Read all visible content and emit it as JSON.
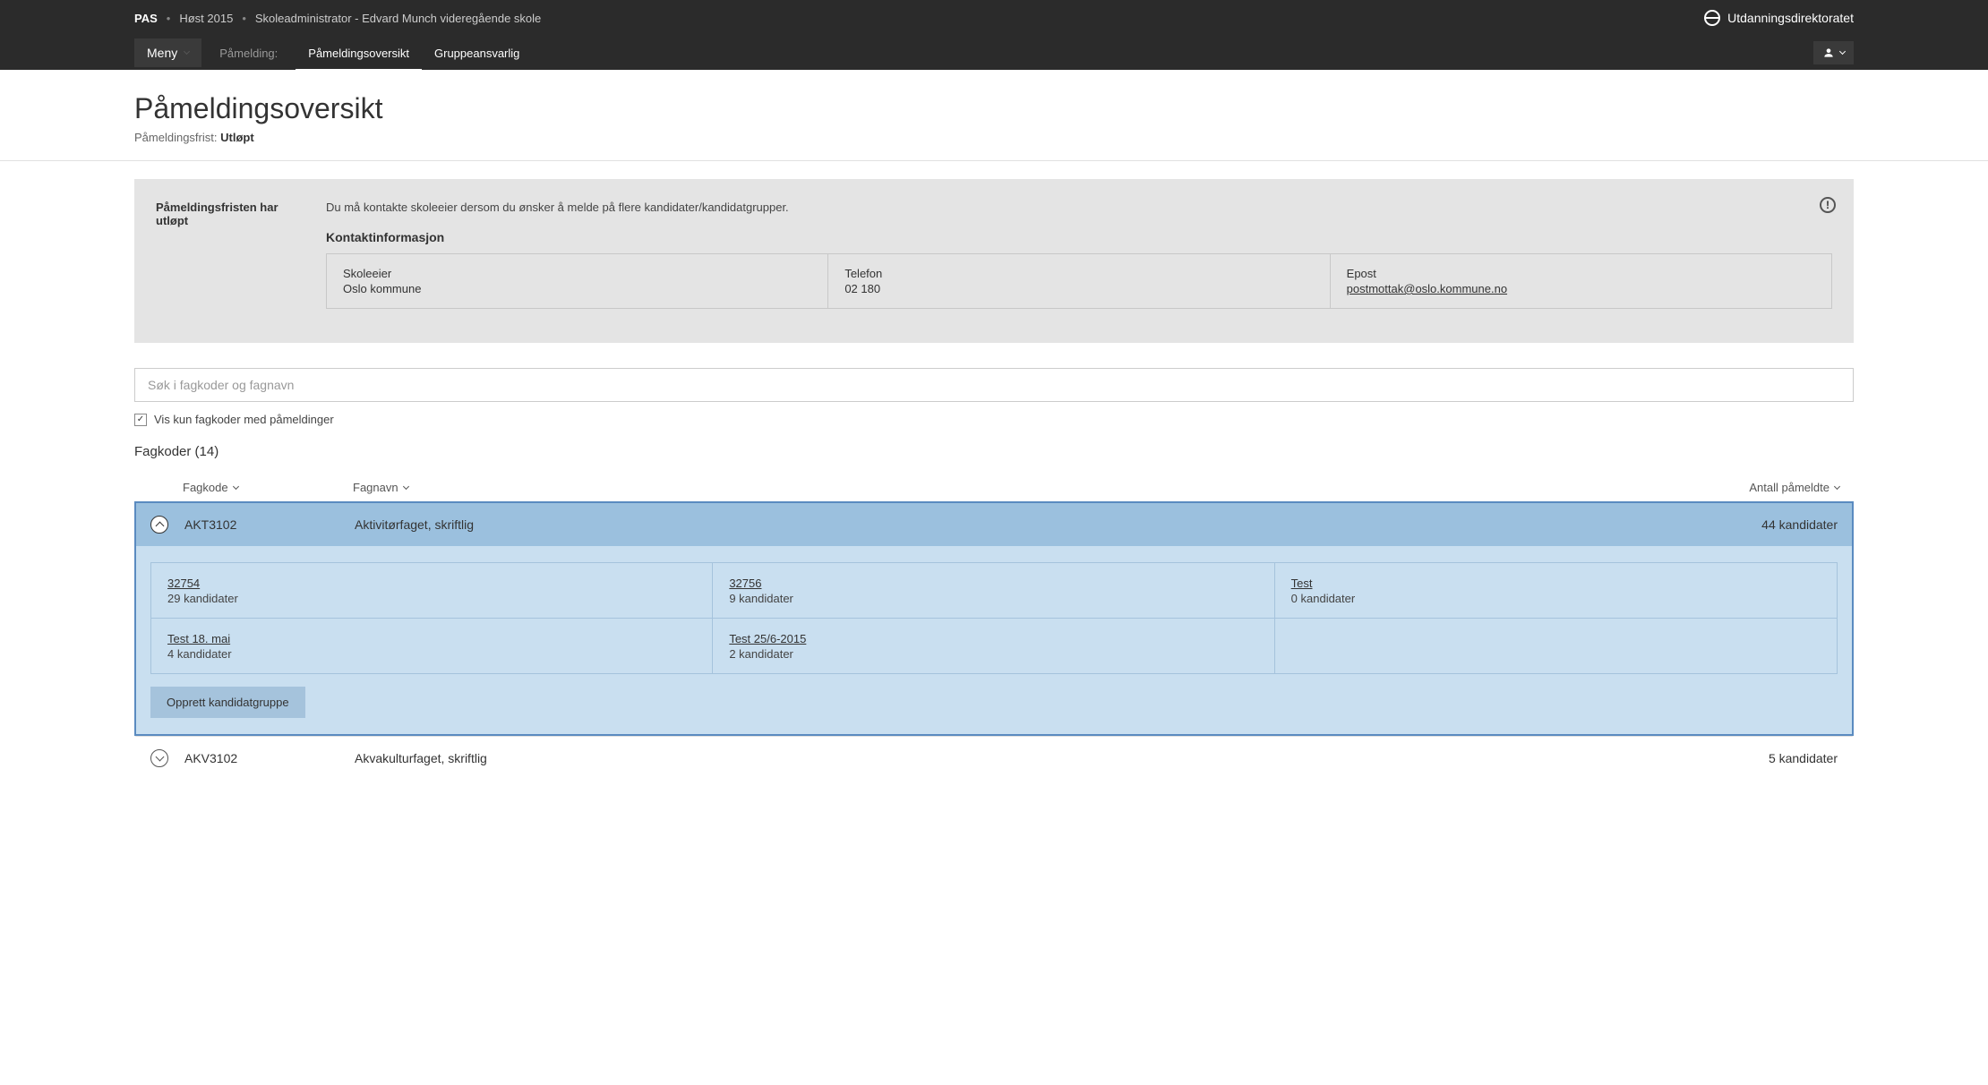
{
  "header": {
    "app_name": "PAS",
    "breadcrumb_term": "Høst 2015",
    "breadcrumb_role": "Skoleadministrator - Edvard Munch videregående skole",
    "org_name": "Utdanningsdirektoratet"
  },
  "nav": {
    "menu_label": "Meny",
    "section_label": "Påmelding:",
    "tabs": [
      {
        "label": "Påmeldingsoversikt",
        "active": true
      },
      {
        "label": "Gruppeansvarlig",
        "active": false
      }
    ]
  },
  "page": {
    "title": "Påmeldingsoversikt",
    "deadline_label": "Påmeldingsfrist:",
    "deadline_value": "Utløpt"
  },
  "info_box": {
    "title": "Påmeldingsfristen har utløpt",
    "description": "Du må kontakte skoleeier dersom du ønsker å melde på flere kandidater/kandidatgrupper.",
    "contact_title": "Kontaktinformasjon",
    "contacts": {
      "owner_label": "Skoleeier",
      "owner_value": "Oslo kommune",
      "phone_label": "Telefon",
      "phone_value": "02 180",
      "email_label": "Epost",
      "email_value": "postmottak@oslo.kommune.no"
    }
  },
  "search": {
    "placeholder": "Søk i fagkoder og fagnavn"
  },
  "filter": {
    "checkbox_label": "Vis kun fagkoder med påmeldinger",
    "checked": true
  },
  "section_title": "Fagkoder (14)",
  "columns": {
    "code": "Fagkode",
    "name": "Fagnavn",
    "count": "Antall påmeldte"
  },
  "fagkoder": [
    {
      "code": "AKT3102",
      "name": "Aktivitørfaget, skriftlig",
      "count": "44 kandidater",
      "expanded": true,
      "groups": [
        {
          "name": "32754",
          "count": "29 kandidater"
        },
        {
          "name": "32756",
          "count": "9 kandidater"
        },
        {
          "name": "Test",
          "count": "0 kandidater"
        },
        {
          "name": "Test 18. mai",
          "count": "4 kandidater"
        },
        {
          "name": "Test 25/6-2015",
          "count": "2 kandidater"
        }
      ],
      "create_button": "Opprett kandidatgruppe"
    },
    {
      "code": "AKV3102",
      "name": "Akvakulturfaget, skriftlig",
      "count": "5 kandidater",
      "expanded": false
    }
  ]
}
